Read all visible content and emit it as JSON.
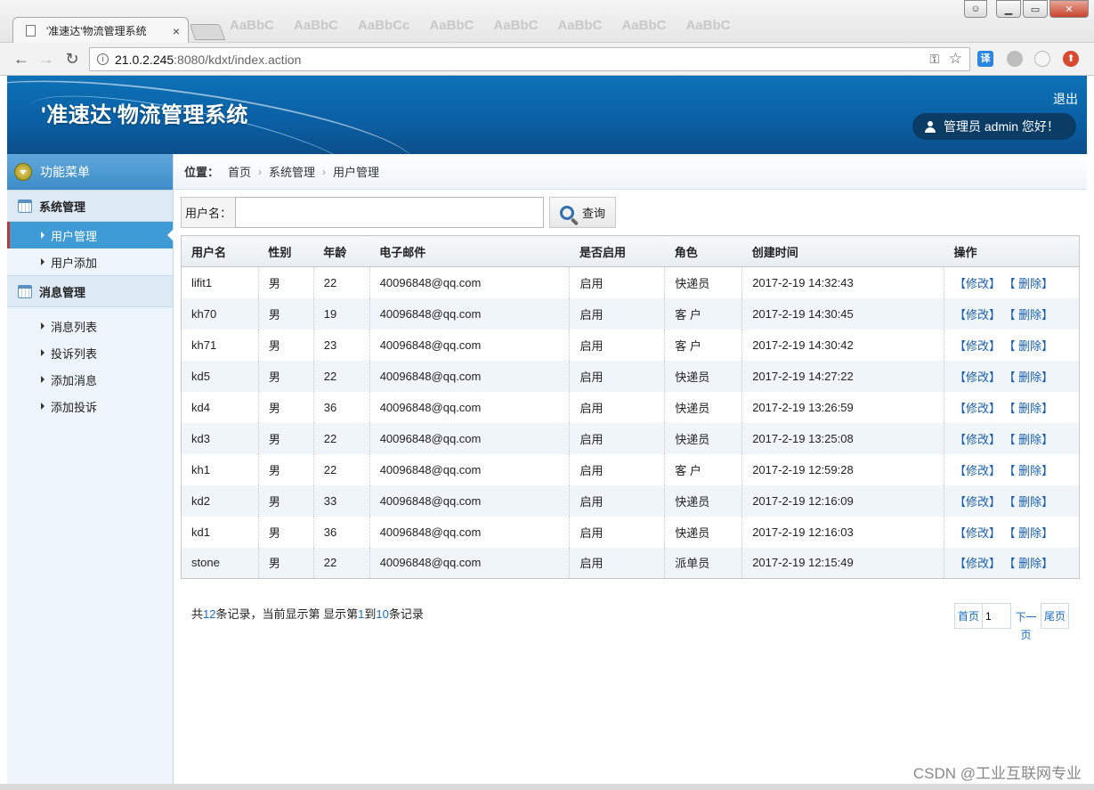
{
  "browser": {
    "tab_title": "'准速达'物流管理系统",
    "tab_close": "×",
    "ghost_style_text": [
      "AaBbC",
      "AaBbC",
      "AaBbCc",
      "AaBbC",
      "AaBbC",
      "AaBbC",
      "AaBbC",
      "AaBbC"
    ],
    "url_host": "21.0.2.245",
    "url_rest": ":8080/kdxt/index.action",
    "translate_label": "译",
    "icons": [
      "back-icon",
      "forward-icon",
      "reload-icon",
      "info-icon",
      "key-icon",
      "star-icon"
    ]
  },
  "header": {
    "title": "'准速达'物流管理系统",
    "logout": "退出",
    "greeting": "管理员  admin 您好！"
  },
  "sidebar": {
    "menu_title": "功能菜单",
    "groups": [
      {
        "label": "系统管理",
        "items": [
          {
            "label": "用户管理",
            "active": true
          },
          {
            "label": "用户添加",
            "active": false
          }
        ]
      },
      {
        "label": "消息管理",
        "items": [
          {
            "label": "消息列表",
            "active": false
          },
          {
            "label": "投诉列表",
            "active": false
          },
          {
            "label": "添加消息",
            "active": false
          },
          {
            "label": "添加投诉",
            "active": false
          }
        ]
      }
    ]
  },
  "breadcrumb": {
    "label": "位置：",
    "items": [
      "首页",
      "系统管理",
      "用户管理"
    ],
    "sep": "›"
  },
  "search": {
    "label": "用户名：",
    "value": "",
    "button": "查询"
  },
  "table": {
    "columns": [
      "用户名",
      "性别",
      "年龄",
      "电子邮件",
      "是否启用",
      "角色",
      "创建时间",
      "操作"
    ],
    "rows": [
      [
        "lifit1",
        "男",
        "22",
        "40096848@qq.com",
        "启用",
        "快递员",
        "2017-2-19 14:32:43"
      ],
      [
        "kh70",
        "男",
        "19",
        "40096848@qq.com",
        "启用",
        "客 户",
        "2017-2-19 14:30:45"
      ],
      [
        "kh71",
        "男",
        "23",
        "40096848@qq.com",
        "启用",
        "客 户",
        "2017-2-19 14:30:42"
      ],
      [
        "kd5",
        "男",
        "22",
        "40096848@qq.com",
        "启用",
        "快递员",
        "2017-2-19 14:27:22"
      ],
      [
        "kd4",
        "男",
        "36",
        "40096848@qq.com",
        "启用",
        "快递员",
        "2017-2-19 13:26:59"
      ],
      [
        "kd3",
        "男",
        "22",
        "40096848@qq.com",
        "启用",
        "快递员",
        "2017-2-19 13:25:08"
      ],
      [
        "kh1",
        "男",
        "22",
        "40096848@qq.com",
        "启用",
        "客 户",
        "2017-2-19 12:59:28"
      ],
      [
        "kd2",
        "男",
        "33",
        "40096848@qq.com",
        "启用",
        "快递员",
        "2017-2-19 12:16:09"
      ],
      [
        "kd1",
        "男",
        "36",
        "40096848@qq.com",
        "启用",
        "快递员",
        "2017-2-19 12:16:03"
      ],
      [
        "stone",
        "男",
        "22",
        "40096848@qq.com",
        "启用",
        "派单员",
        "2017-2-19 12:15:49"
      ]
    ],
    "edit_label": "【修改】",
    "delete_label": "【 删除】"
  },
  "footer": {
    "t1": "共",
    "total": "12",
    "t2": "条记录，当前显示第  显示第",
    "from": "1",
    "t3": "到",
    "to": "10",
    "t4": "条记录"
  },
  "pager": {
    "first": "首页",
    "page_value": "1",
    "next_1": "下一",
    "next_2": "页",
    "last": "尾页"
  },
  "watermark": "CSDN @工业互联网专业",
  "colors": {
    "header_blue": "#0a5fa3",
    "sidebar_active": "#3f9bd6",
    "link_blue": "#1a5fae"
  }
}
